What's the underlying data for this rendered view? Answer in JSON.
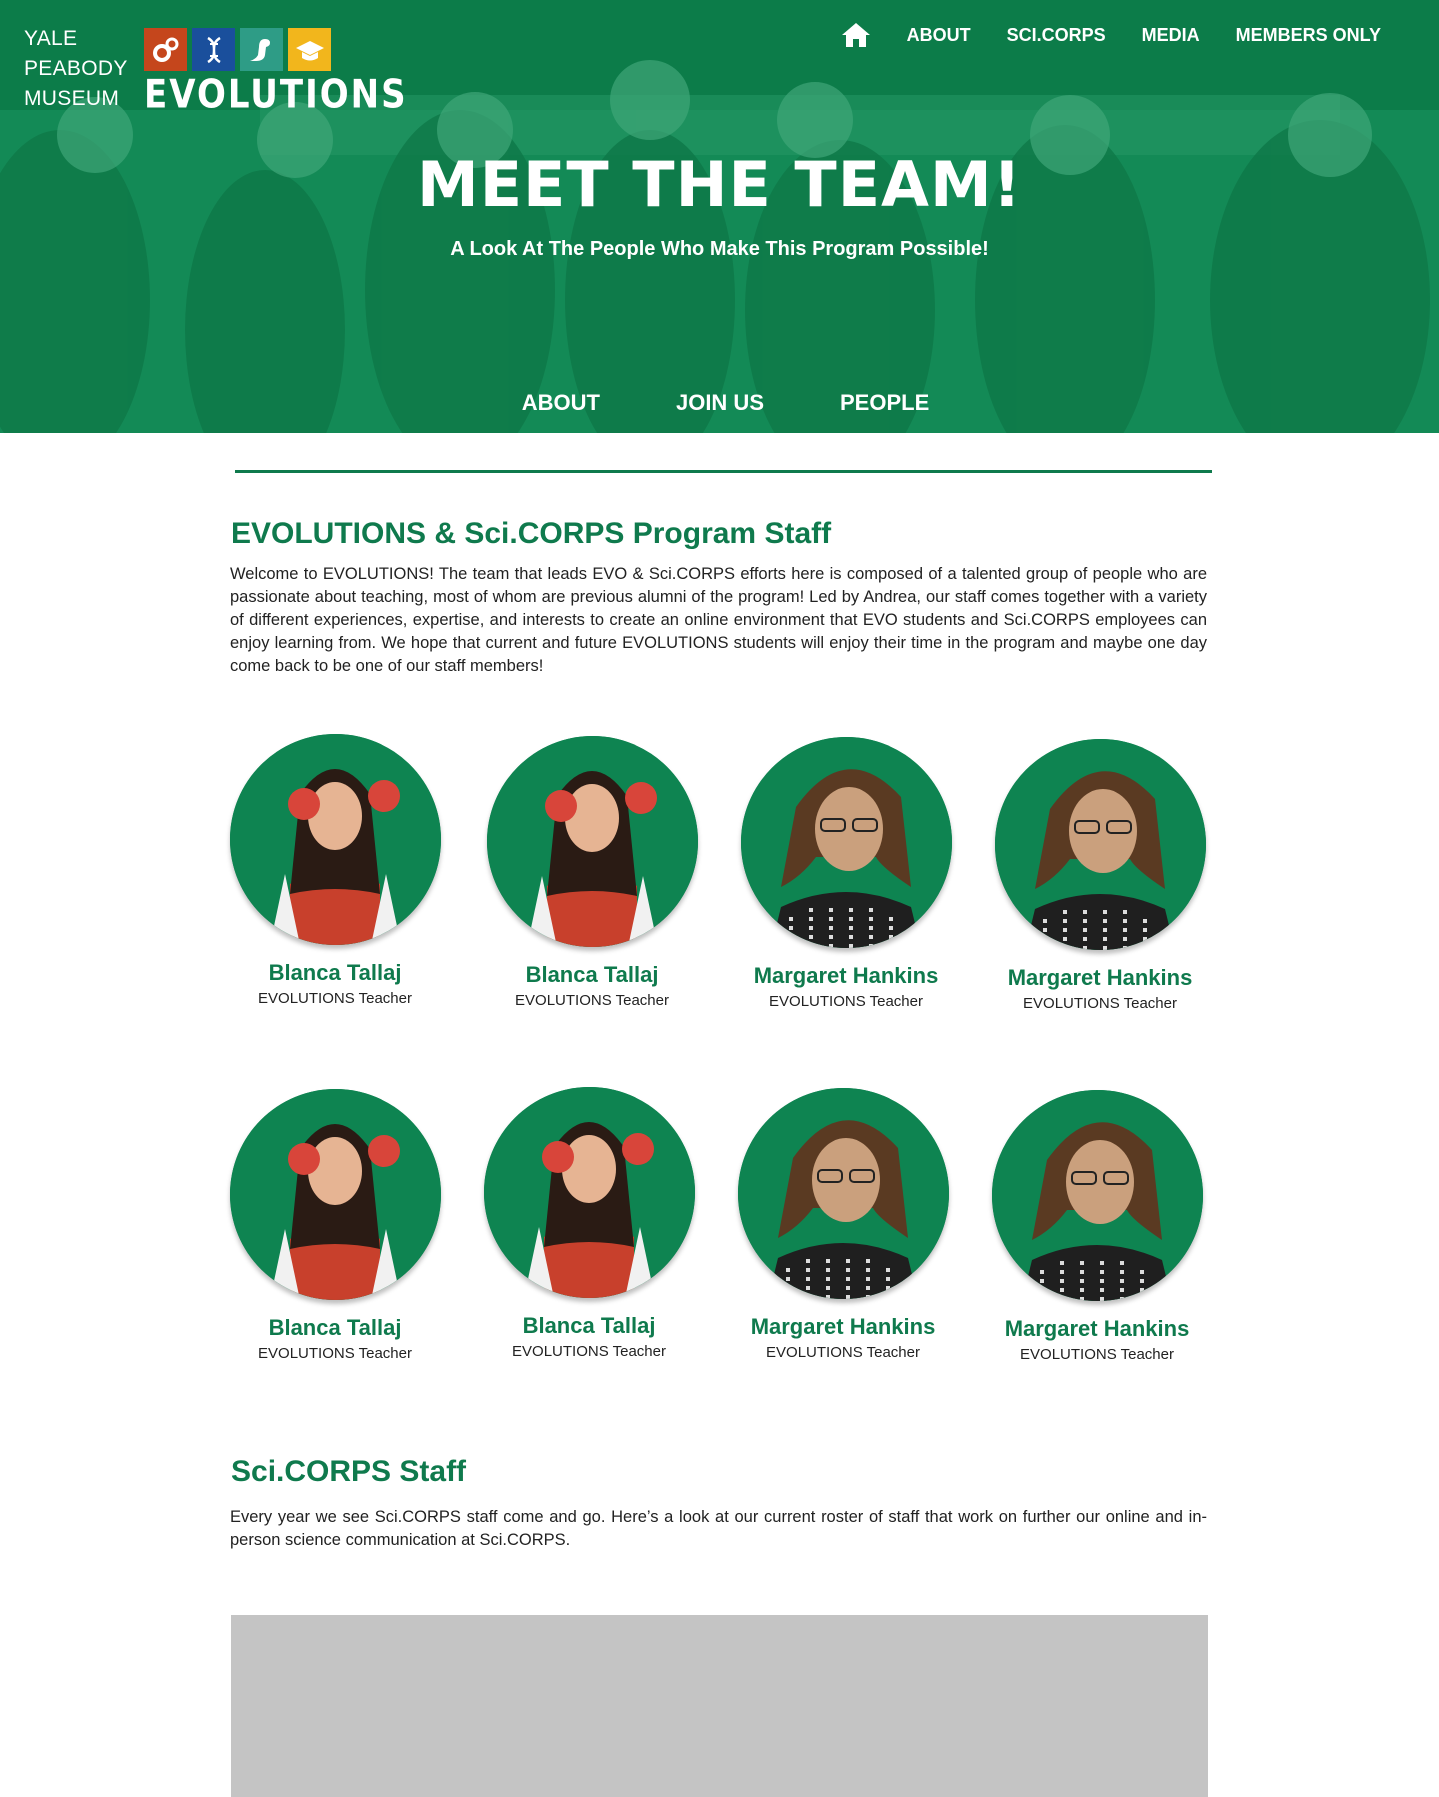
{
  "brand": {
    "line1": "YALE",
    "line2": "PEABODY",
    "line3": "MUSEUM",
    "logo_text": "EVOLUTIONS"
  },
  "nav": {
    "about": "ABOUT",
    "scicorps": "SCI.CORPS",
    "media": "MEDIA",
    "members": "MEMBERS ONLY"
  },
  "hero": {
    "title": "MEET THE TEAM!",
    "subtitle": "A Look At The People Who Make This Program Possible!"
  },
  "subnav": {
    "about": "ABOUT",
    "join": "JOIN US",
    "people": "PEOPLE"
  },
  "program_staff": {
    "title": "EVOLUTIONS & Sci.CORPS Program Staff",
    "text": "Welcome to EVOLUTIONS! The team that leads EVO & Sci.CORPS efforts here is composed of a talented group of people who are passionate about teaching, most of whom are previous alumni of the program! Led by Andrea, our staff comes together with a variety of different experiences, expertise, and interests to create an online environment that EVO students and Sci.CORPS employees can enjoy learning from. We hope that current and future EVOLUTIONS students will enjoy their time in the program and maybe one day come back to be one of our staff members!",
    "people": [
      {
        "name": "Blanca Tallaj",
        "role": "EVOLUTIONS Teacher"
      },
      {
        "name": "Blanca Tallaj",
        "role": "EVOLUTIONS Teacher"
      },
      {
        "name": "Margaret Hankins",
        "role": "EVOLUTIONS Teacher"
      },
      {
        "name": "Margaret Hankins",
        "role": "EVOLUTIONS Teacher"
      },
      {
        "name": "Blanca Tallaj",
        "role": "EVOLUTIONS Teacher"
      },
      {
        "name": "Blanca Tallaj",
        "role": "EVOLUTIONS Teacher"
      },
      {
        "name": "Margaret Hankins",
        "role": "EVOLUTIONS Teacher"
      },
      {
        "name": "Margaret Hankins",
        "role": "EVOLUTIONS Teacher"
      }
    ]
  },
  "scicorps_staff": {
    "title": "Sci.CORPS Staff",
    "text": "Every year we see Sci.CORPS staff come and go. Here’s a look at our current roster of staff that work on further our online and in-person science communication at Sci.CORPS."
  },
  "colors": {
    "brand_green": "#0f7a4d",
    "avatar_green": "#0e8451",
    "tile_orange": "#c5461c",
    "tile_blue": "#1a4f9c",
    "tile_teal": "#2e9c86",
    "tile_yellow": "#f2b61c",
    "placeholder_gray": "#c4c4c4"
  },
  "icons": {
    "home": "home-icon",
    "tile1": "gears-icon",
    "tile2": "dna-icon",
    "tile3": "dinosaur-icon",
    "tile4": "graduation-cap-icon"
  }
}
